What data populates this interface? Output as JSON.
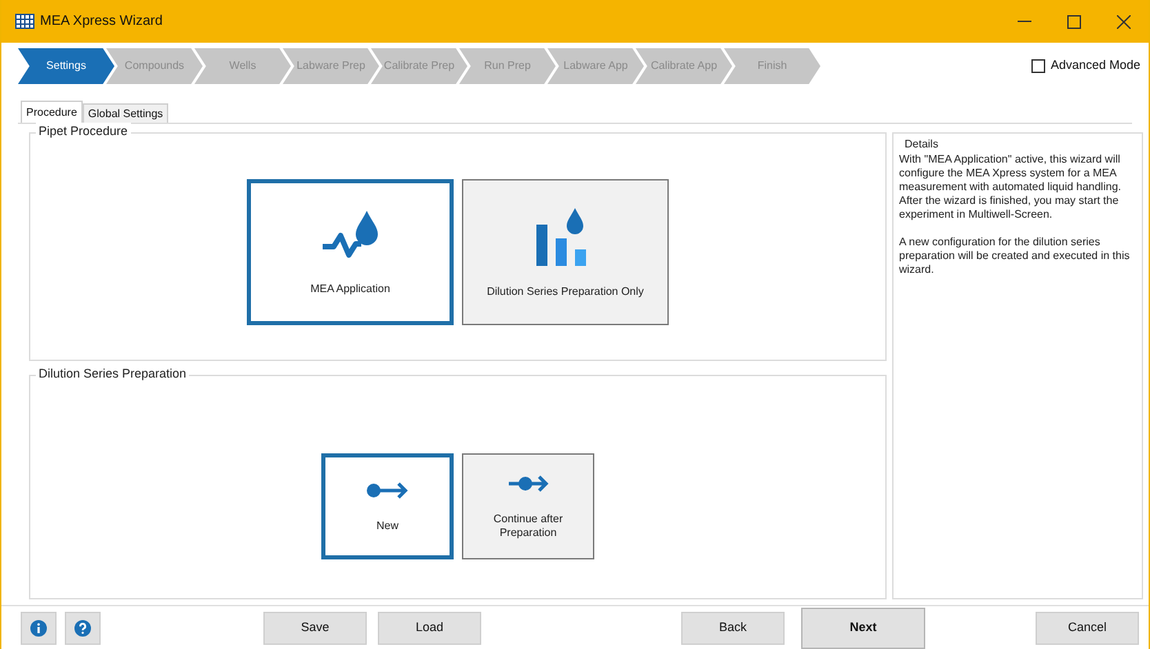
{
  "window": {
    "title": "MEA Xpress Wizard"
  },
  "steps": [
    {
      "label": "Settings",
      "selected": true
    },
    {
      "label": "Compounds",
      "selected": false
    },
    {
      "label": "Wells",
      "selected": false
    },
    {
      "label": "Labware Prep",
      "selected": false
    },
    {
      "label": "Calibrate Prep",
      "selected": false
    },
    {
      "label": "Run Prep",
      "selected": false
    },
    {
      "label": "Labware App",
      "selected": false
    },
    {
      "label": "Calibrate App",
      "selected": false
    },
    {
      "label": "Finish",
      "selected": false
    }
  ],
  "advanced_mode": {
    "label": "Advanced Mode",
    "checked": false
  },
  "tabs": [
    {
      "label": "Procedure",
      "selected": true
    },
    {
      "label": "Global Settings",
      "selected": false
    }
  ],
  "groups": [
    {
      "title": "Pipet Procedure",
      "kind": "large",
      "options": [
        {
          "label": "MEA Application",
          "kind": "wave",
          "selected": true
        },
        {
          "label": "Dilution Series Preparation Only",
          "kind": "bars",
          "selected": false
        }
      ]
    },
    {
      "title": "Dilution Series Preparation",
      "kind": "small",
      "options": [
        {
          "label": "New",
          "kind": "new",
          "selected": true
        },
        {
          "label": "Continue after Preparation",
          "kind": "continue",
          "selected": false
        }
      ]
    }
  ],
  "details": {
    "title": "Details",
    "paragraphs": [
      "With \"MEA Application\" active, this wizard will configure the MEA Xpress system for a MEA measurement with automated liquid handling. After the wizard is finished, you may start the experiment in Multiwell-Screen.",
      "A new configuration for the dilution series preparation will be created and executed in this wizard."
    ]
  },
  "buttons": [
    {
      "label": "Save",
      "kind": "normal"
    },
    {
      "label": "Load",
      "kind": "normal"
    },
    {
      "label": "Back",
      "kind": "normal"
    },
    {
      "label": "Next",
      "kind": "default"
    },
    {
      "label": "Cancel",
      "kind": "normal"
    }
  ]
}
